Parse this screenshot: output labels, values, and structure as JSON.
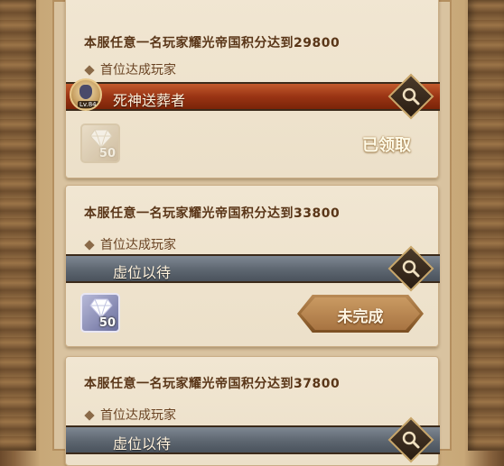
{
  "quests": [
    {
      "title": "本服任意一名玩家耀光帝国积分达到29800",
      "subtitle": "首位达成玩家",
      "player": {
        "name": "死神送葬者",
        "level": "Lv.84"
      },
      "reward": {
        "count": "50"
      },
      "status": "已领取"
    },
    {
      "title": "本服任意一名玩家耀光帝国积分达到33800",
      "subtitle": "首位达成玩家",
      "player": {
        "name": "虚位以待"
      },
      "reward": {
        "count": "50"
      },
      "status": "未完成"
    },
    {
      "title": "本服任意一名玩家耀光帝国积分达到37800",
      "subtitle": "首位达成玩家",
      "player": {
        "name": "虚位以待"
      }
    }
  ],
  "icons": {
    "search": "magnifier-icon",
    "reward": "diamond-icon",
    "bullet": "diamond-bullet-icon"
  }
}
